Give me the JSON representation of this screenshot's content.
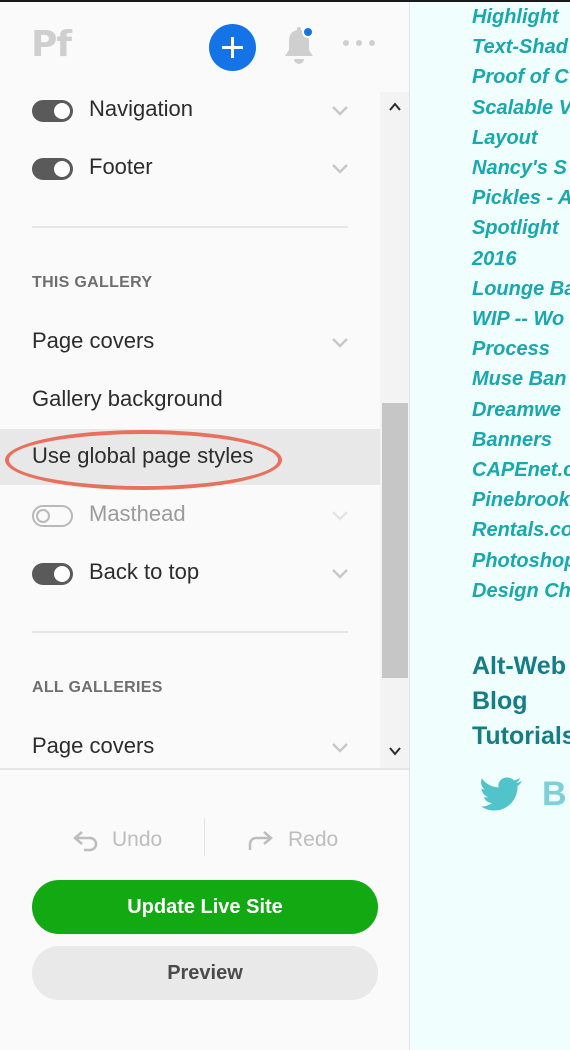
{
  "header": {
    "logo": "Pf",
    "add_icon": "plus-icon",
    "notifications_icon": "bell-icon",
    "more_icon": "ellipsis-icon",
    "accent": "#1473e6"
  },
  "panel": {
    "items_top": [
      {
        "label": "Navigation",
        "toggle": true,
        "on": true
      },
      {
        "label": "Footer",
        "toggle": true,
        "on": true
      }
    ],
    "this_gallery": {
      "heading": "THIS GALLERY",
      "items": [
        {
          "label": "Page covers"
        },
        {
          "label": "Gallery background"
        },
        {
          "label": "Use global page styles",
          "highlighted": true
        },
        {
          "label": "Masthead",
          "toggle": true,
          "on": false
        },
        {
          "label": "Back to top",
          "toggle": true,
          "on": true
        }
      ]
    },
    "all_galleries": {
      "heading": "ALL GALLERIES",
      "items": [
        {
          "label": "Page covers"
        }
      ]
    }
  },
  "footer": {
    "undo_label": "Undo",
    "redo_label": "Redo",
    "update_label": "Update Live Site",
    "preview_label": "Preview",
    "update_color": "#12a912"
  },
  "site": {
    "links": [
      "Highlight",
      "Text-Shad",
      "Proof of C",
      "Scalable V",
      "Layout",
      "Nancy's S",
      "Pickles - A",
      "Spotlight",
      "2016",
      "Lounge Ba",
      "WIP -- Wo",
      "Process",
      "Muse Ban",
      "Dreamwe",
      "Banners",
      "CAPEnet.c",
      "Pinebrook",
      "Rentals.co",
      "Photoshop",
      "Design Ch"
    ],
    "nav": [
      "Alt-Web",
      "Blog",
      "Tutorials"
    ],
    "social_letter": "B",
    "link_color": "#1aa7ad"
  }
}
